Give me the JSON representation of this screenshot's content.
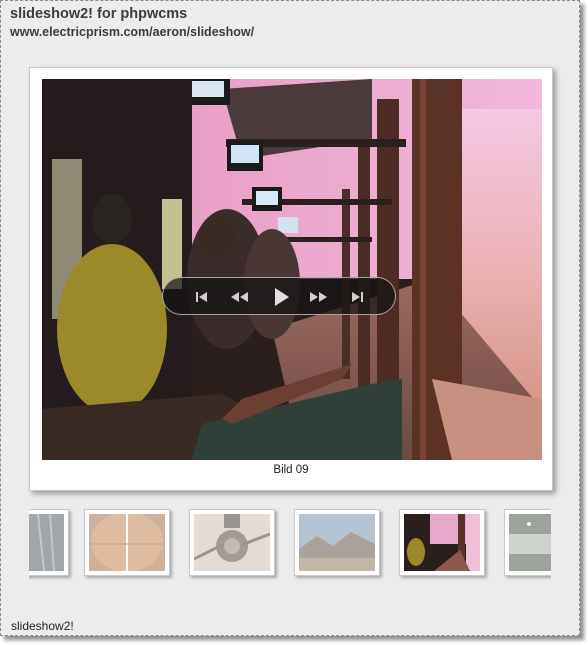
{
  "header": {
    "title": "slideshow2! for phpwcms",
    "url": "www.electricprism.com/aeron/slideshow/"
  },
  "slideshow": {
    "caption": "Bild 09",
    "controls": [
      {
        "name": "first-button",
        "icon": "skip-first-icon"
      },
      {
        "name": "previous-button",
        "icon": "rewind-icon"
      },
      {
        "name": "play-button",
        "icon": "play-icon"
      },
      {
        "name": "next-button",
        "icon": "fast-forward-icon"
      },
      {
        "name": "last-button",
        "icon": "skip-last-icon"
      }
    ],
    "thumbnails": [
      {
        "name": "thumbnail-1",
        "state": "faded"
      },
      {
        "name": "thumbnail-2",
        "state": "faded"
      },
      {
        "name": "thumbnail-3",
        "state": "faded"
      },
      {
        "name": "thumbnail-4",
        "state": "faded"
      },
      {
        "name": "thumbnail-5",
        "state": "active"
      },
      {
        "name": "thumbnail-6",
        "state": "faded"
      }
    ]
  },
  "footer": {
    "label": "slideshow2!"
  },
  "colors": {
    "background": "#ececec",
    "text": "#3c3c3c",
    "control_bar": "#141414"
  }
}
